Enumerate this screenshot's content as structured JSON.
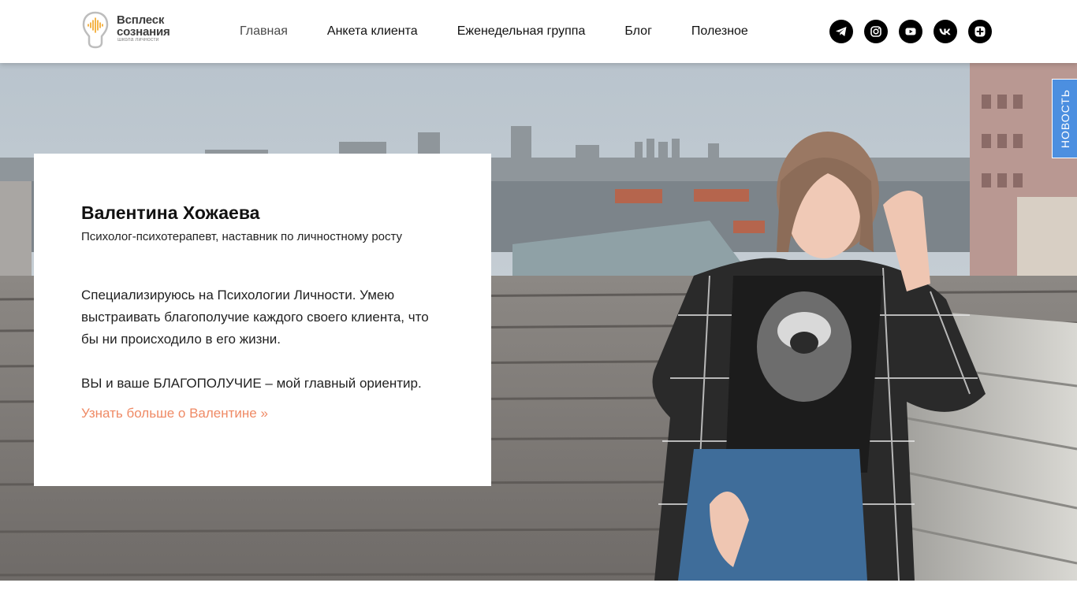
{
  "logo": {
    "title": "Всплеск\nсознания",
    "subtitle": "школа личности",
    "accent_color": "#f2a21b"
  },
  "nav": {
    "items": [
      {
        "label": "Главная",
        "active": true
      },
      {
        "label": "Анкета клиента",
        "active": false
      },
      {
        "label": "Еженедельная группа",
        "active": false
      },
      {
        "label": "Блог",
        "active": false
      },
      {
        "label": "Полезное",
        "active": false
      }
    ]
  },
  "socials": [
    {
      "icon": "telegram-icon"
    },
    {
      "icon": "instagram-icon"
    },
    {
      "icon": "youtube-icon"
    },
    {
      "icon": "vk-icon"
    },
    {
      "icon": "plus-icon"
    }
  ],
  "hero": {
    "name": "Валентина Хожаева",
    "role": "Психолог-психотерапевт, наставник по личностному росту",
    "text": "Специализируюсь на Психологии Личности. Умею выстраивать благополучие каждого своего клиента, что бы ни происходило в его жизни.\n\nВЫ и ваше БЛАГОПОЛУЧИЕ – мой главный ориентир.",
    "link": "Узнать больше о Валентине »",
    "link_color": "#ef8a65"
  },
  "news_tab": {
    "label": "НОВОСТЬ",
    "color": "#4c8fe0"
  }
}
